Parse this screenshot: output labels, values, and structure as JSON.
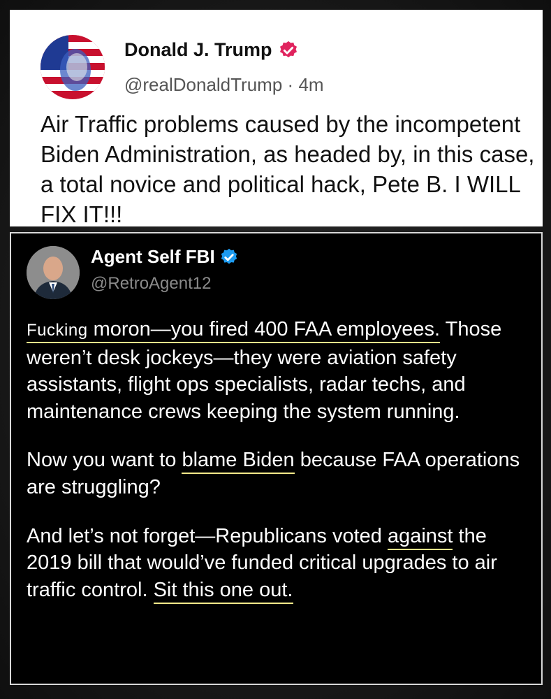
{
  "top_post": {
    "author_name": "Donald J. Trump",
    "handle": "@realDonaldTrump",
    "separator": "·",
    "time": "4m",
    "text": "Air Traffic problems caused by the incompetent Biden Administration, as headed by, in this case, a total novice and political hack, Pete B. I WILL FIX IT!!!",
    "verified_badge_color": "#e0245e"
  },
  "reply_post": {
    "author_name": "Agent Self FBI",
    "handle": "@RetroAgent12",
    "verified_badge_color": "#1d9bf0",
    "highlight_color": "#f3e98a",
    "p1": {
      "w1": "Fucking",
      "t1": " moron—you fired 400 FAA employees.",
      "t2": " Those weren’t desk jockeys—they were aviation safety assistants, flight ops specialists, radar techs, and maintenance crews keeping the system running."
    },
    "p2": {
      "t1": "Now you want to ",
      "h1": "blame Biden",
      "t2": " because FAA operations are struggling?"
    },
    "p3": {
      "t1": "And let’s not forget—Republicans voted ",
      "h1": "against",
      "t2": " the 2019 bill that would’ve funded critical upgrades to air traffic control. ",
      "h2": "Sit this one out."
    }
  }
}
